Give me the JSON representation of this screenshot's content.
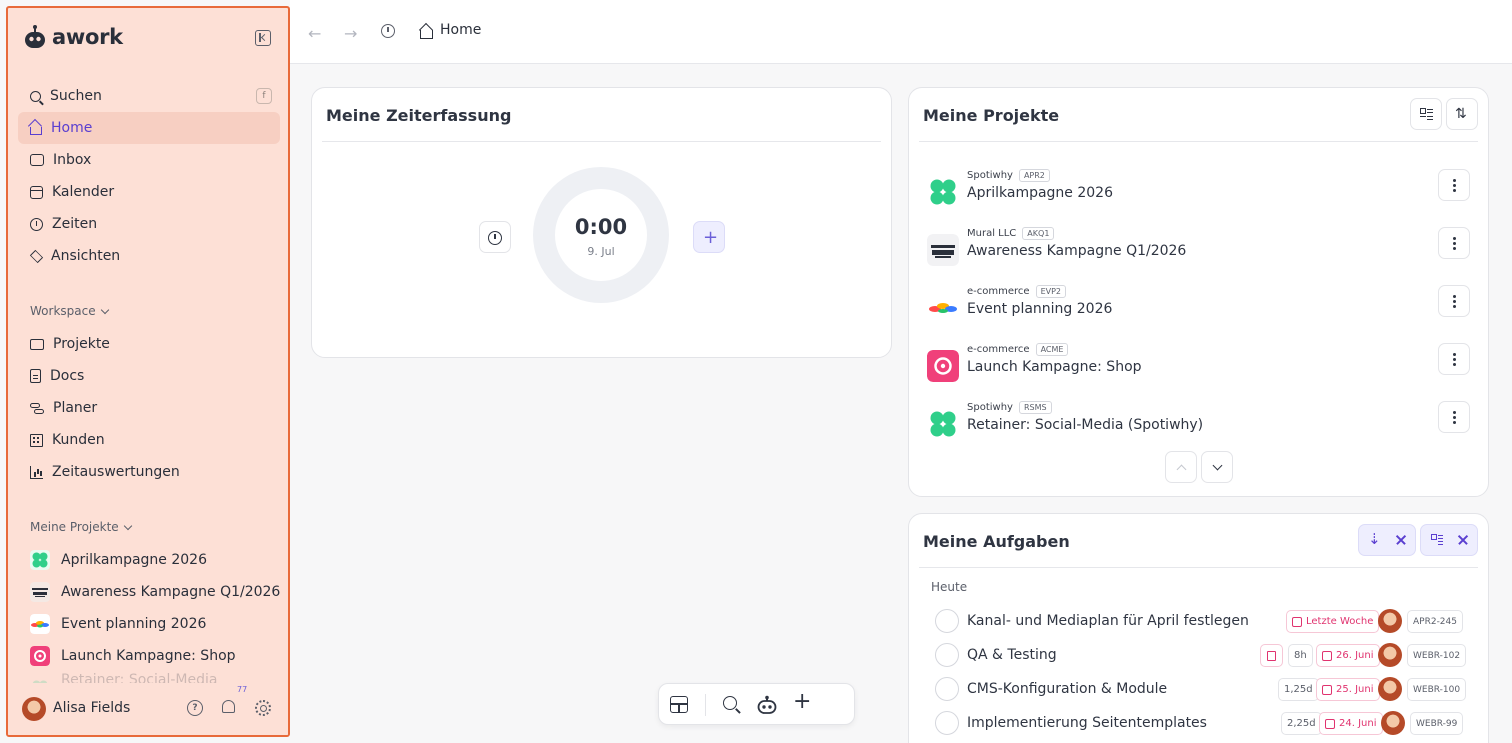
{
  "app": {
    "logo_text": "awork"
  },
  "sidebar": {
    "search": {
      "label": "Suchen",
      "shortcut": "f"
    },
    "items": [
      {
        "label": "Home",
        "icon": "home-icon",
        "active": true
      },
      {
        "label": "Inbox",
        "icon": "inbox-icon"
      },
      {
        "label": "Kalender",
        "icon": "calendar-icon"
      },
      {
        "label": "Zeiten",
        "icon": "stopwatch-icon"
      },
      {
        "label": "Ansichten",
        "icon": "layers-icon"
      }
    ],
    "workspace_label": "Workspace",
    "workspace_items": [
      {
        "label": "Projekte",
        "icon": "folder-icon"
      },
      {
        "label": "Docs",
        "icon": "document-icon"
      },
      {
        "label": "Planer",
        "icon": "planner-icon"
      },
      {
        "label": "Kunden",
        "icon": "building-icon"
      },
      {
        "label": "Zeitauswertungen",
        "icon": "chart-icon"
      }
    ],
    "my_projects_label": "Meine Projekte",
    "projects": [
      {
        "label": "Aprilkampagne 2026",
        "logo": "spotiwhy-logo",
        "color": "#2fcf8a"
      },
      {
        "label": "Awareness Kampagne Q1/2026",
        "logo": "mural-logo",
        "color": "#2a2f3a"
      },
      {
        "label": "Event planning 2026",
        "logo": "ecommerce-rainbow-logo",
        "color": "#ff4a4a"
      },
      {
        "label": "Launch Kampagne: Shop",
        "logo": "ecommerce-pink-logo",
        "color": "#f0407a"
      },
      {
        "label": "Retainer: Social-Media (Spotiwhy)",
        "logo": "spotiwhy-logo",
        "color": "#2fcf8a"
      }
    ],
    "user": {
      "name": "Alisa Fields",
      "notification_count": "77"
    }
  },
  "topbar": {
    "breadcrumb": "Home"
  },
  "time_tracking": {
    "title": "Meine Zeiterfassung",
    "timer": "0:00",
    "date": "9. Jul"
  },
  "projects_card": {
    "title": "Meine Projekte",
    "rows": [
      {
        "client": "Spotiwhy",
        "key": "APR2",
        "name": "Aprilkampagne 2026"
      },
      {
        "client": "Mural LLC",
        "key": "AKQ1",
        "name": "Awareness Kampagne Q1/2026"
      },
      {
        "client": "e-commerce",
        "key": "EVP2",
        "name": "Event planning 2026"
      },
      {
        "client": "e-commerce",
        "key": "ACME",
        "name": "Launch Kampagne: Shop"
      },
      {
        "client": "Spotiwhy",
        "key": "RSMS",
        "name": "Retainer: Social-Media (Spotiwhy)"
      }
    ]
  },
  "tasks_card": {
    "title": "Meine Aufgaben",
    "group": "Heute",
    "tasks": [
      {
        "name": "Kanal- und Mediaplan für April festlegen",
        "due": "Letzte Woche",
        "key": "APR2-245"
      },
      {
        "name": "QA & Testing",
        "effort": "8h",
        "due": "26. Juni",
        "key": "WEBR-102"
      },
      {
        "name": "CMS-Konfiguration & Module",
        "effort": "1,25d",
        "due": "25. Juni",
        "key": "WEBR-100"
      },
      {
        "name": "Implementierung Seitentemplates",
        "effort": "2,25d",
        "due": "24. Juni",
        "key": "WEBR-99"
      }
    ]
  },
  "colors": {
    "accent": "#5a3fd0",
    "sidebar_bg": "#fde0d6",
    "sidebar_border": "#e86a3a",
    "due_red": "#e0336f"
  }
}
